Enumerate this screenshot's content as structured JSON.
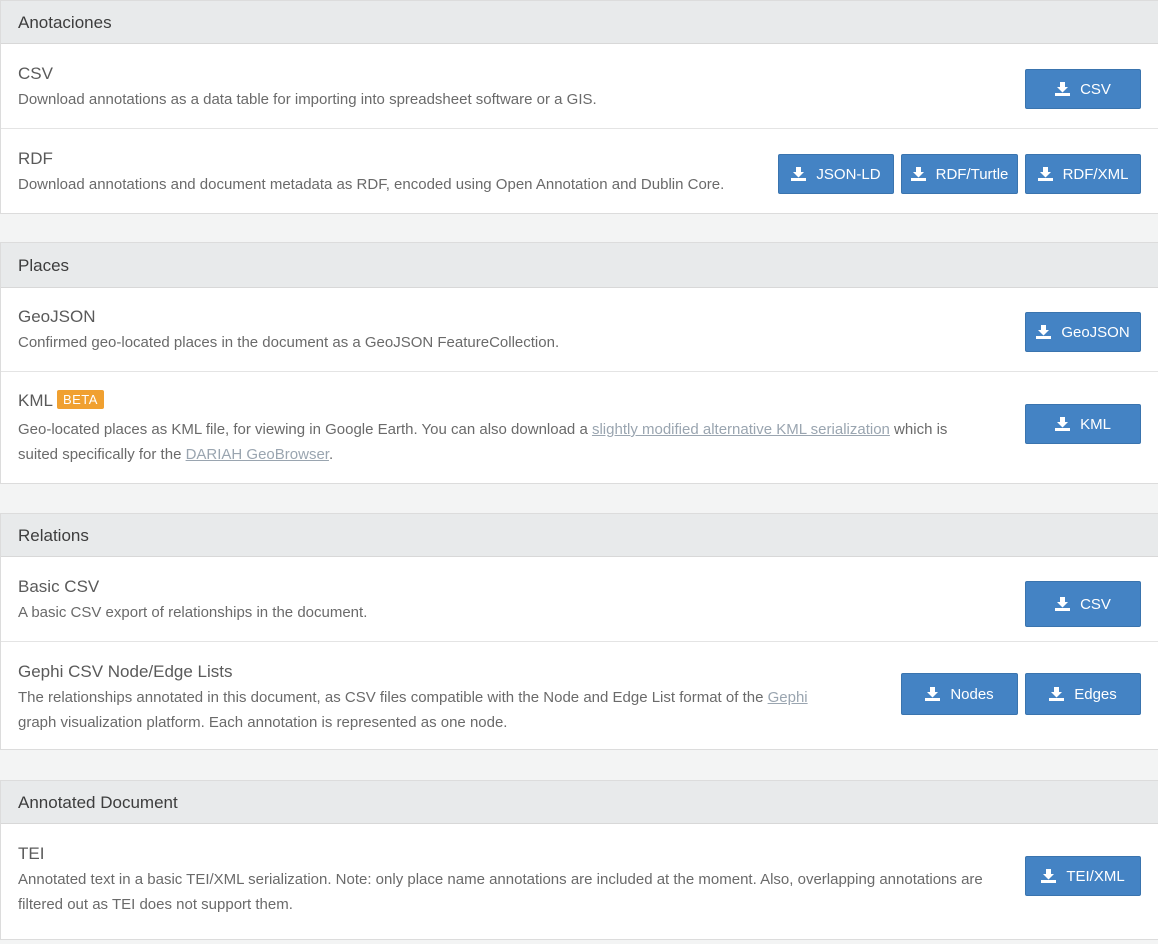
{
  "sections": {
    "annotations": {
      "title": "Anotaciones",
      "csv": {
        "title": "CSV",
        "desc": "Download annotations as a data table for importing into spreadsheet software or a GIS.",
        "btn": "CSV"
      },
      "rdf": {
        "title": "RDF",
        "desc": "Download annotations and document metadata as RDF, encoded using Open Annotation and Dublin Core.",
        "btn_jsonld": "JSON-LD",
        "btn_turtle": "RDF/Turtle",
        "btn_xml": "RDF/XML"
      }
    },
    "places": {
      "title": "Places",
      "geojson": {
        "title": "GeoJSON",
        "desc": "Confirmed geo-located places in the document as a GeoJSON FeatureCollection.",
        "btn": "GeoJSON"
      },
      "kml": {
        "title": "KML",
        "badge": "BETA",
        "desc_1": "Geo-located places as KML file, for viewing in Google Earth. You can also download a ",
        "link_1": "slightly modified alternative KML serialization",
        "desc_2": " which is suited specifically for the ",
        "link_2": "DARIAH GeoBrowser",
        "desc_3": ".",
        "btn": "KML"
      }
    },
    "relations": {
      "title": "Relations",
      "basic_csv": {
        "title": "Basic CSV",
        "desc": "A basic CSV export of relationships in the document.",
        "btn": "CSV"
      },
      "gephi": {
        "title": "Gephi CSV Node/Edge Lists",
        "desc_1": "The relationships annotated in this document, as CSV files compatible with the Node and Edge List format of the ",
        "link_1": "Gephi",
        "desc_2": " graph visualization platform. Each annotation is represented as one node.",
        "btn_nodes": "Nodes",
        "btn_edges": "Edges"
      }
    },
    "annotated_document": {
      "title": "Annotated Document",
      "tei": {
        "title": "TEI",
        "desc": "Annotated text in a basic TEI/XML serialization. Note: only place name annotations are included at the moment. Also, overlapping annotations are filtered out as TEI does not support them.",
        "btn": "TEI/XML"
      }
    }
  },
  "icons": {
    "download": "download-icon"
  },
  "colors": {
    "button": "#4483c4",
    "badge": "#f0a030",
    "header_bg": "#e8eaeb"
  }
}
